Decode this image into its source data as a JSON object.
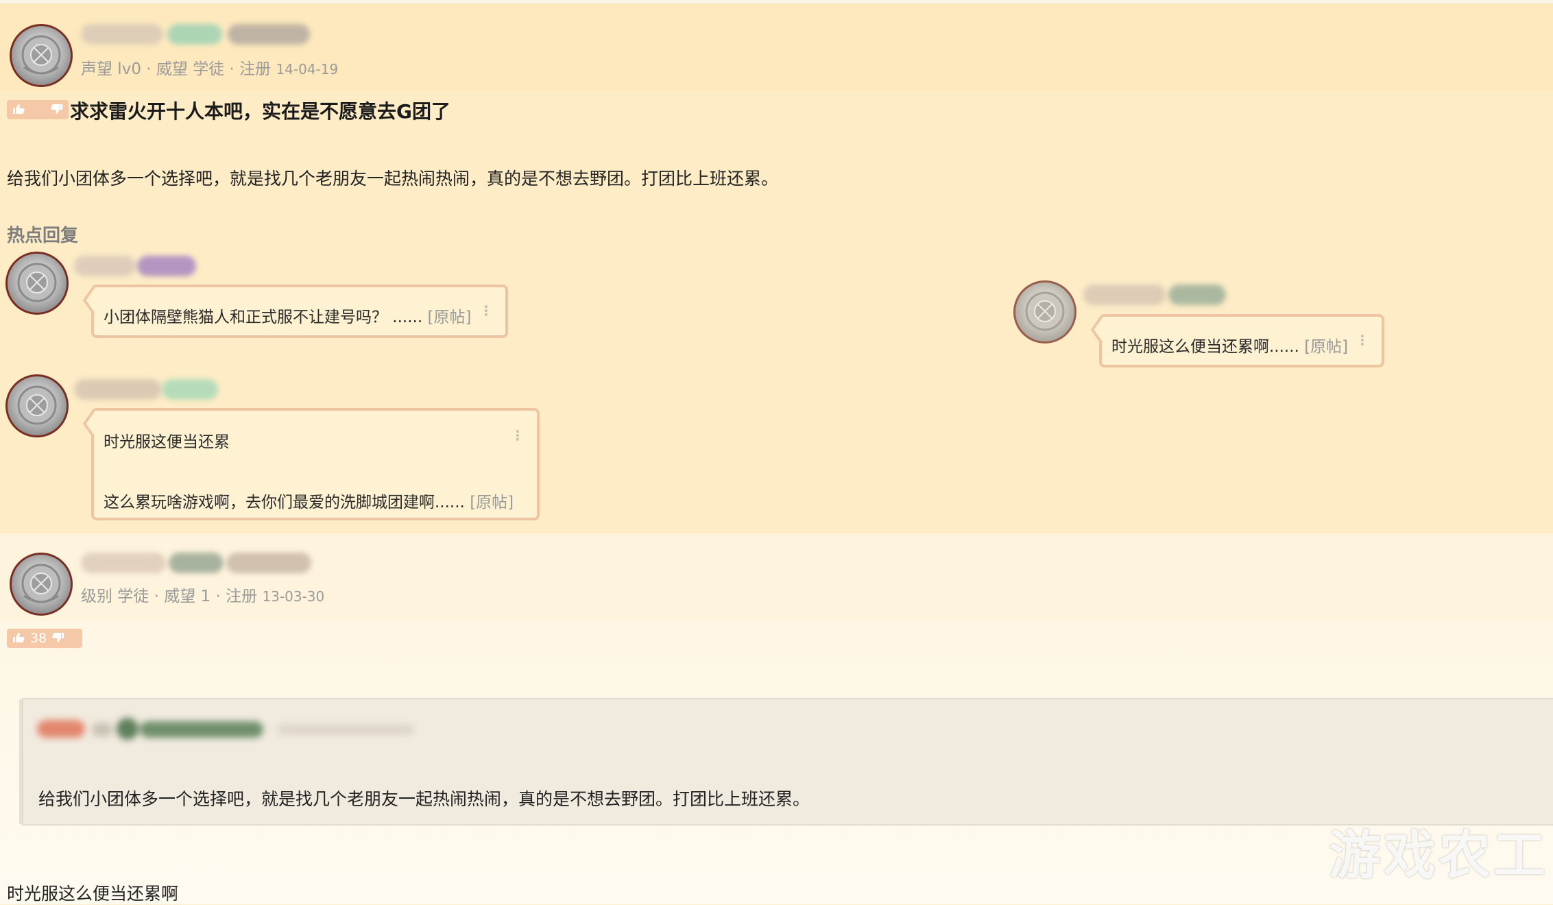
{
  "colors": {
    "page_background": "#fdecc6",
    "bubble_border": "#edc5a2",
    "vote_badge": "#f5c8a8",
    "avatar_ring": "#7a2d22",
    "meta_text": "#9a9a9a"
  },
  "thread": {
    "author_meta": {
      "text": "声望 lv0 · 威望 学徒 · 注册 ",
      "date": "14-04-19"
    },
    "vote": {
      "up_icon": "thumbs-up-icon",
      "down_icon": "thumbs-down-icon"
    },
    "title": "求求雷火开十人本吧，实在是不愿意去G团了",
    "body": "给我们小团体多一个选择吧，就是找几个老朋友一起热闹热闹，真的是不想去野团。打团比上班还累。"
  },
  "hot_replies": {
    "header": "热点回复",
    "items": [
      {
        "lines": [
          "小团体隔壁熊猫人和正式服不让建号吗？ ......"
        ],
        "orig_link": "[原帖]"
      },
      {
        "lines": [
          "时光服这便当还累",
          "这么累玩啥游戏啊，去你们最爱的洗脚城团建啊......"
        ],
        "orig_link": "[原帖]"
      },
      {
        "lines": [
          "时光服这么便当还累啊......"
        ],
        "orig_link": "[原帖]"
      }
    ]
  },
  "reply_post": {
    "author_meta": {
      "text": "级别 学徒 · 威望 1 · 注册 ",
      "date": "13-03-30"
    },
    "vote": {
      "count": "38",
      "up_icon": "thumbs-up-icon",
      "down_icon": "thumbs-down-icon"
    },
    "quote_text": "给我们小团体多一个选择吧，就是找几个老朋友一起热闹热闹，真的是不想去野团。打团比上班还累。",
    "content": "时光服这么便当还累啊"
  },
  "watermark": "游戏农工"
}
